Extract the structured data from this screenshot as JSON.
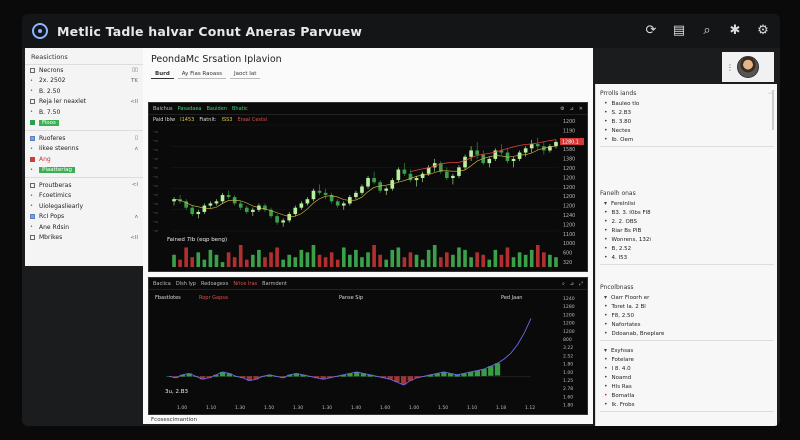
{
  "app": {
    "title": "Metlic Tadle halvar Conut Aneras Parvuew"
  },
  "titlebar": {
    "icons": [
      "refresh-icon",
      "document-icon",
      "search-icon",
      "settings-icon",
      "gear-icon"
    ]
  },
  "sidebar": {
    "header": "Reasictions",
    "items": [
      {
        "label": "Necrons",
        "trail": "▯▯",
        "box": "plain"
      },
      {
        "label": "2x. 2502",
        "trail": "TK",
        "box": "none"
      },
      {
        "label": "B. 2.50",
        "trail": "",
        "box": "none"
      },
      {
        "label": "Reja ler neaxlet",
        "trail": "<lI",
        "box": "plain"
      },
      {
        "label": "B. 7.50",
        "trail": "",
        "box": "none"
      },
      {
        "label": "Fioos",
        "trail": "",
        "box": "green",
        "tag": "green"
      },
      {
        "label": "Ruoferes",
        "trail": "▯",
        "box": "blue"
      },
      {
        "label": "Iikee steenns",
        "trail": "ʌ",
        "box": "none"
      },
      {
        "label": "Ang",
        "trail": "",
        "box": "red"
      },
      {
        "label": "Plaatteriag",
        "trail": "",
        "box": "none",
        "tag": "green"
      },
      {
        "label": "Proutberas",
        "trail": "<I",
        "box": "plain"
      },
      {
        "label": "Fcoetimics",
        "trail": "",
        "box": "none"
      },
      {
        "label": "Uiolegasliearly",
        "trail": "",
        "box": "none"
      },
      {
        "label": "RcI Pops",
        "trail": "ʌ",
        "box": "blue"
      },
      {
        "label": "Ane Rdsin",
        "trail": "",
        "box": "none"
      },
      {
        "label": "Mbrikes",
        "trail": "<lI",
        "box": "plain"
      }
    ]
  },
  "main": {
    "title": "PeondaMc Srsation Iplavion",
    "tabs": [
      "Burd",
      "Ay Fias Raoass",
      "Jaoct Iat"
    ],
    "bottom": "Fcosescimantion"
  },
  "chart1": {
    "toolbar": {
      "a": "Baichus",
      "b": "Pasadaea",
      "c": "Bauiden",
      "d": "Bhatic"
    },
    "legend": {
      "a": "Paid Iblw",
      "b": "I1453",
      "c": "Fiatnlt:",
      "d": "ISS3",
      "e": "Eraal Cestsl"
    },
    "volume_label": "Fained 7lb (eqp beng)",
    "price_ticks": [
      "1200",
      "1190",
      "1680",
      "1580",
      "1380",
      "1200",
      "1200",
      "1200",
      "1200",
      "1200",
      "1240",
      "1200",
      "1100",
      "1000",
      "600",
      "320"
    ],
    "last_price": "1280.1"
  },
  "chart1_data": {
    "type": "candlestick",
    "candles": [
      [
        54,
        56,
        52,
        55
      ],
      [
        55,
        57,
        53,
        54
      ],
      [
        54,
        55,
        50,
        51
      ],
      [
        51,
        52,
        47,
        48
      ],
      [
        48,
        50,
        46,
        49
      ],
      [
        49,
        53,
        48,
        52
      ],
      [
        52,
        54,
        51,
        53
      ],
      [
        53,
        55,
        52,
        54
      ],
      [
        54,
        58,
        53,
        57
      ],
      [
        57,
        59,
        55,
        56
      ],
      [
        56,
        57,
        52,
        53
      ],
      [
        53,
        54,
        50,
        51
      ],
      [
        51,
        52,
        48,
        49
      ],
      [
        49,
        51,
        47,
        50
      ],
      [
        50,
        53,
        49,
        52
      ],
      [
        52,
        53,
        49,
        50
      ],
      [
        50,
        51,
        46,
        47
      ],
      [
        47,
        48,
        43,
        44
      ],
      [
        44,
        46,
        42,
        45
      ],
      [
        45,
        49,
        44,
        48
      ],
      [
        48,
        52,
        47,
        51
      ],
      [
        51,
        54,
        50,
        53
      ],
      [
        53,
        56,
        52,
        55
      ],
      [
        55,
        60,
        54,
        59
      ],
      [
        59,
        62,
        57,
        58
      ],
      [
        58,
        60,
        55,
        57
      ],
      [
        57,
        58,
        53,
        54
      ],
      [
        54,
        55,
        51,
        52
      ],
      [
        52,
        54,
        50,
        53
      ],
      [
        53,
        57,
        52,
        56
      ],
      [
        56,
        59,
        55,
        58
      ],
      [
        58,
        62,
        57,
        61
      ],
      [
        61,
        66,
        60,
        65
      ],
      [
        65,
        68,
        62,
        63
      ],
      [
        63,
        64,
        58,
        59
      ],
      [
        59,
        61,
        57,
        60
      ],
      [
        60,
        65,
        59,
        64
      ],
      [
        64,
        70,
        63,
        69
      ],
      [
        69,
        72,
        66,
        67
      ],
      [
        67,
        69,
        63,
        64
      ],
      [
        64,
        66,
        61,
        65
      ],
      [
        65,
        68,
        63,
        67
      ],
      [
        67,
        71,
        66,
        70
      ],
      [
        70,
        74,
        68,
        72
      ],
      [
        72,
        73,
        67,
        68
      ],
      [
        68,
        70,
        64,
        65
      ],
      [
        65,
        67,
        62,
        66
      ],
      [
        66,
        71,
        65,
        70
      ],
      [
        70,
        76,
        69,
        75
      ],
      [
        75,
        80,
        73,
        78
      ],
      [
        78,
        82,
        74,
        76
      ],
      [
        76,
        78,
        71,
        72
      ],
      [
        72,
        75,
        70,
        74
      ],
      [
        74,
        79,
        73,
        78
      ],
      [
        78,
        81,
        76,
        77
      ],
      [
        77,
        79,
        72,
        73
      ],
      [
        73,
        75,
        70,
        74
      ],
      [
        74,
        78,
        73,
        77
      ],
      [
        77,
        80,
        75,
        79
      ],
      [
        79,
        83,
        77,
        81
      ],
      [
        81,
        84,
        78,
        80
      ],
      [
        80,
        82,
        76,
        78
      ],
      [
        78,
        81,
        77,
        80
      ],
      [
        80,
        83,
        79,
        82
      ]
    ],
    "volume": [
      5,
      3,
      8,
      4,
      6,
      3,
      7,
      5,
      2,
      6,
      4,
      9,
      3,
      5,
      7,
      4,
      6,
      8,
      3,
      5,
      4,
      7,
      6,
      9,
      5,
      4,
      6,
      3,
      8,
      5,
      7,
      4,
      6,
      9,
      5,
      3,
      7,
      8,
      4,
      6,
      5,
      3,
      7,
      9,
      4,
      6,
      5,
      8,
      7,
      4,
      6,
      5,
      3,
      7,
      5,
      8,
      4,
      6,
      5,
      7,
      9,
      6,
      5,
      4
    ],
    "ylim": [
      40,
      90
    ]
  },
  "chart2": {
    "toolbar": {
      "a": "Baciica",
      "b": "Dlsh lyp",
      "c": "Redoagexs",
      "d": "Nrice Iras",
      "e": "Barmdent"
    },
    "legend": {
      "a": "Fbastlotes",
      "b": "Ropr Gapsa",
      "c": "Panse Sip",
      "d": "Ped Jaan"
    },
    "corner_label": "3u, 2.B3",
    "y_ticks": [
      "1240",
      "1280",
      "1200",
      "1200",
      "1200",
      "800",
      "3.22",
      "2.52",
      "1.80",
      "1.00",
      "1.25",
      "2.78",
      "1.60",
      "1.80"
    ],
    "x_ticks": [
      "1.00",
      "1.10",
      "1.30",
      "1.50",
      "1.30",
      "1.30",
      "1.40",
      "1.60",
      "1.00",
      "1.50",
      "1.10",
      "1.18",
      "1.12"
    ]
  },
  "chart2_data": {
    "type": "line+histogram",
    "line": [
      0,
      -1,
      1,
      2,
      0,
      -2,
      -1,
      1,
      3,
      2,
      0,
      -1,
      -3,
      -2,
      0,
      1,
      0,
      -1,
      1,
      2,
      1,
      0,
      -1,
      -2,
      -1,
      0,
      1,
      2,
      3,
      2,
      1,
      0,
      -1,
      -2,
      -4,
      -6,
      -3,
      -1,
      0,
      1,
      2,
      3,
      2,
      1,
      2,
      3,
      4,
      5,
      7,
      9,
      12,
      16,
      22,
      30,
      40
    ],
    "ylim": [
      -15,
      50
    ]
  },
  "right_panel": {
    "section1": {
      "head": "Prrolls iands",
      "items": [
        "Bauleo tlo",
        "S. 2.B3",
        "B. 3.80",
        "Nectes",
        "Ib. Oem"
      ]
    },
    "section2": {
      "head": "Fanelh onas",
      "items": [
        "Ferelnlisi",
        "B3. 3. l0bs Fl8",
        "2. 2. OBS",
        "Riar Bs PlB",
        "Wonrens, 132i",
        "B, 2.52",
        "4. I53"
      ]
    },
    "section3": {
      "head": "Pncolbnass",
      "items": [
        "Oarr Floorh er",
        "Toret Ia. 2 Bl",
        "F8, 2.50",
        "Nafortates",
        "Ddoanab, Bneplare"
      ]
    },
    "section4": {
      "items": [
        "Esyhsas",
        "Fotelare",
        "I 8. 4.0",
        "Noamd",
        "Hls Ras",
        "Bomatla",
        "Ik. Frobs"
      ]
    }
  }
}
